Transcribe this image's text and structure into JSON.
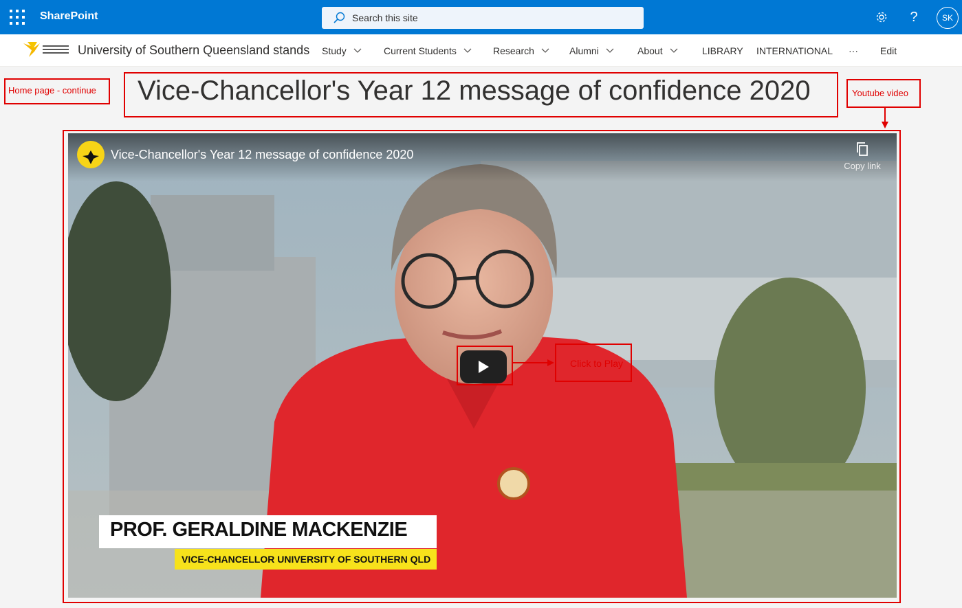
{
  "suite": {
    "brand": "SharePoint",
    "search_placeholder": "Search this site",
    "help_label": "?",
    "avatar_initials": "SK"
  },
  "site": {
    "title": "University of Southern Queensland stands",
    "nav": [
      {
        "label": "Study"
      },
      {
        "label": "Current Students"
      },
      {
        "label": "Research"
      },
      {
        "label": "Alumni"
      },
      {
        "label": "About"
      },
      {
        "label": "LIBRARY"
      },
      {
        "label": "INTERNATIONAL"
      },
      {
        "label": "···"
      },
      {
        "label": "Edit"
      }
    ]
  },
  "page": {
    "title": "Vice-Chancellor's Year 12 message of confidence 2020"
  },
  "annotations": {
    "home": "Home page - continue",
    "youtube": "Youtube video",
    "click_to_play": "Click to Play",
    "color": "#e00000"
  },
  "video": {
    "title": "Vice-Chancellor's Year 12 message of confidence 2020",
    "copy_link": "Copy link",
    "name_caption": "PROF. GERALDINE MACKENZIE",
    "role_caption": "VICE-CHANCELLOR UNIVERSITY OF SOUTHERN QLD"
  },
  "colors": {
    "suite_bar": "#0078d4",
    "annotation": "#e00000",
    "caption_yellow": "#f7e21b"
  }
}
